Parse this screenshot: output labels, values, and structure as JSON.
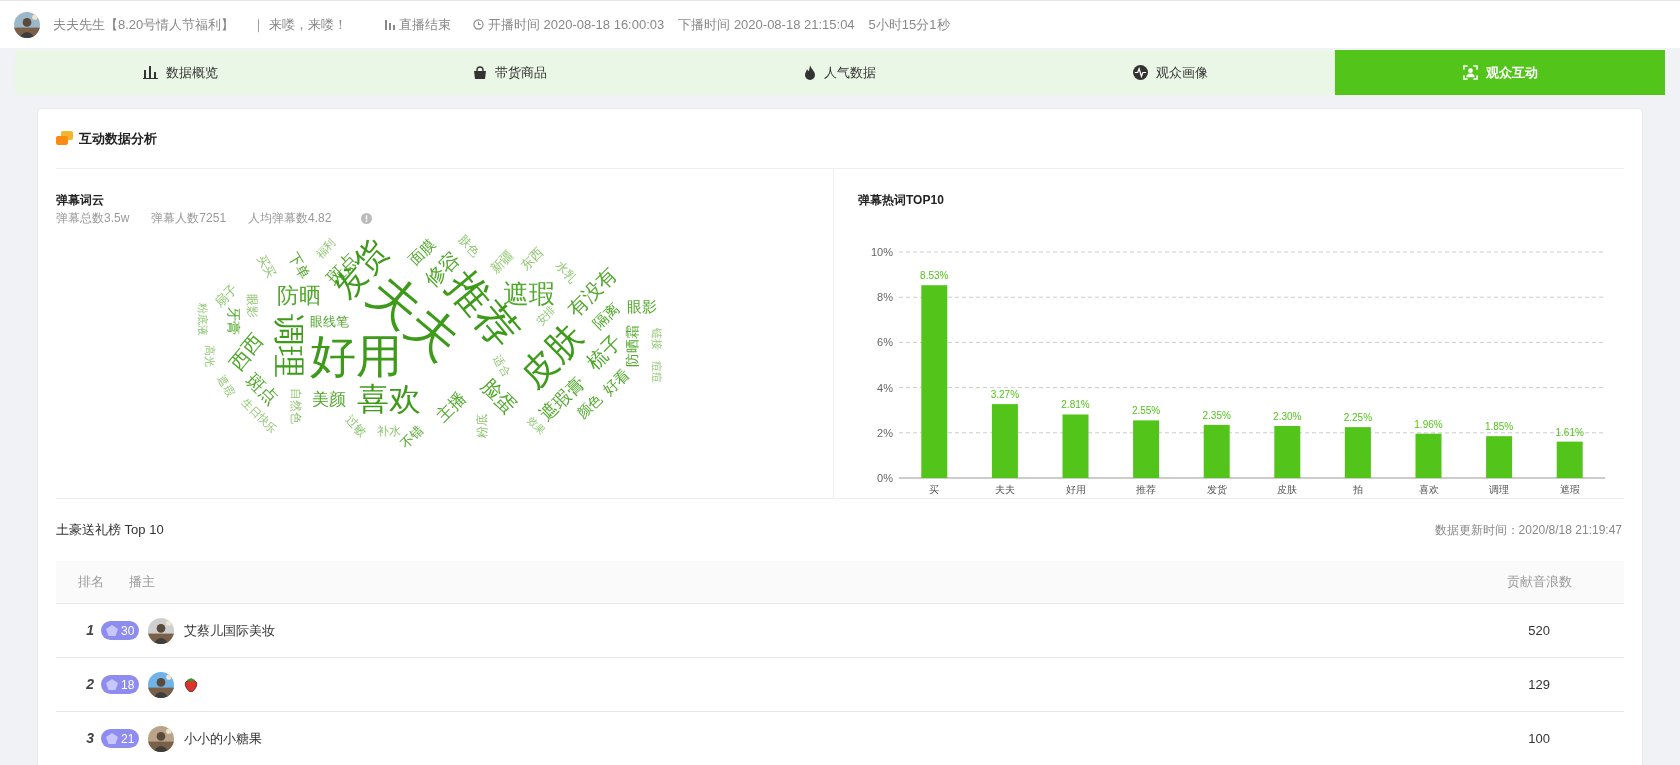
{
  "header": {
    "anchor": "夫夫先生【8.20号情人节福利】",
    "slogan": "｜ 来喽，来喽！",
    "status": "直播结束",
    "start": "开播时间 2020-08-18 16:00:03",
    "end": "下播时间 2020-08-18 21:15:04",
    "duration": "5小时15分1秒"
  },
  "tabs": [
    {
      "label": "数据概览",
      "selected": false
    },
    {
      "label": "带货商品",
      "selected": false
    },
    {
      "label": "人气数据",
      "selected": false
    },
    {
      "label": "观众画像",
      "selected": false
    },
    {
      "label": "观众互动",
      "selected": true
    }
  ],
  "card": {
    "title": "互动数据分析"
  },
  "word_cloud": {
    "title": "弹幕词云",
    "stats": [
      "弹幕总数3.5w",
      "弹幕人数7251",
      "人均弹幕数4.82"
    ],
    "words": [
      "粉底液",
      "高光",
      "扇子",
      "遮瑕",
      "牙膏",
      "西西",
      "眼影",
      "生日快乐",
      "斑点",
      "买买",
      "调理",
      "自然色",
      "防晒",
      "下单",
      "福利",
      "眼线笔",
      "斑点",
      "好用",
      "美颜",
      "过敏",
      "发货",
      "喜欢",
      "补水",
      "夫夫",
      "不错",
      "面膜",
      "修容",
      "主播",
      "肤色",
      "推荐",
      "粉底",
      "脸蛋",
      "新疆",
      "适合",
      "遮瑕",
      "东西",
      "效果",
      "安排",
      "皮肤",
      "遮瑕膏",
      "水乳",
      "颜色",
      "有没有",
      "梳子",
      "隔离",
      "好看",
      "防晒霜",
      "眼影",
      "链接",
      "痘痘"
    ]
  },
  "top_words": {
    "title": "弹幕热词TOP10",
    "chart_data": {
      "type": "bar",
      "grid": true,
      "categories": [
        "买",
        "夫夫",
        "好用",
        "推荐",
        "发货",
        "皮肤",
        "拍",
        "喜欢",
        "调理",
        "遮瑕"
      ],
      "values": [
        8.53,
        3.27,
        2.81,
        2.55,
        2.35,
        2.3,
        2.25,
        1.96,
        1.85,
        1.61
      ],
      "ylim": [
        0,
        10
      ],
      "yticks": [
        {
          "value": 0,
          "label": "0%"
        },
        {
          "value": 2,
          "label": "2%"
        },
        {
          "value": 4,
          "label": "4%"
        },
        {
          "value": 6,
          "label": "6%"
        },
        {
          "value": 8,
          "label": "8%"
        },
        {
          "value": 10,
          "label": "10%"
        }
      ],
      "value_labels": [
        "8.53%",
        "3.27%",
        "2.81%",
        "2.55%",
        "2.35%",
        "2.30%",
        "2.25%",
        "1.96%",
        "1.85%",
        "1.61%"
      ]
    }
  },
  "gift_ranking": {
    "title": "土豪送礼榜 Top 10",
    "updated": "数据更新时间：2020/8/18 21:19:47",
    "columns": [
      "排名",
      "播主",
      "贡献音浪数"
    ],
    "rows": [
      {
        "rank": "1",
        "level": "30",
        "kind": "text",
        "name": "艾蔡儿国际美妆",
        "amount": "520"
      },
      {
        "rank": "2",
        "level": "18",
        "kind": "emoji",
        "amount": "129"
      },
      {
        "rank": "3",
        "level": "21",
        "kind": "text",
        "name": "小小的小糖果",
        "amount": "100"
      }
    ]
  }
}
